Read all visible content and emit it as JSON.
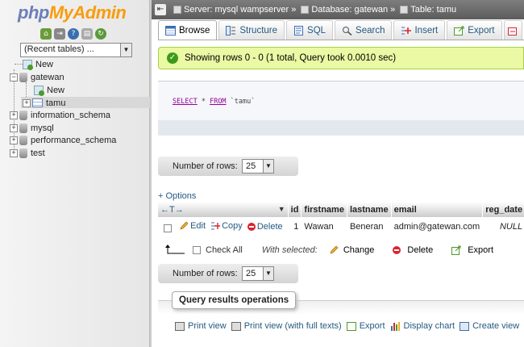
{
  "nav": {
    "logo_php": "php",
    "logo_myadmin": "MyAdmin",
    "recent_tables": "(Recent tables) ...",
    "tree": [
      {
        "label": "New"
      },
      {
        "label": "gatewan"
      },
      {
        "label": "New"
      },
      {
        "label": "tamu"
      },
      {
        "label": "information_schema"
      },
      {
        "label": "mysql"
      },
      {
        "label": "performance_schema"
      },
      {
        "label": "test"
      }
    ]
  },
  "breadcrumb": {
    "server": "Server: mysql wampserver",
    "sep1": "»",
    "database": "Database: gatewan",
    "sep2": "»",
    "table": "Table: tamu"
  },
  "tabs": [
    {
      "label": "Browse"
    },
    {
      "label": "Structure"
    },
    {
      "label": "SQL"
    },
    {
      "label": "Search"
    },
    {
      "label": "Insert"
    },
    {
      "label": "Export"
    }
  ],
  "success_message": "Showing rows 0 - 0 (1 total, Query took 0.0010 sec)",
  "sql": {
    "select": "SELECT",
    "star": " * ",
    "from": "FROM",
    "table": " `tamu`"
  },
  "rows_control": {
    "label": "Number of rows:",
    "value": "25"
  },
  "options_link": "+ Options",
  "table": {
    "sort_arrows": "←T→",
    "columns": [
      "id",
      "firstname",
      "lastname",
      "email",
      "reg_date"
    ],
    "row_actions": {
      "edit": "Edit",
      "copy": "Copy",
      "delete": "Delete"
    },
    "rows": [
      {
        "id": "1",
        "firstname": "Wawan",
        "lastname": "Beneran",
        "email": "admin@gatewan.com",
        "reg_date": "NULL"
      }
    ]
  },
  "bulk": {
    "check_all": "Check All",
    "with_selected": "With selected:",
    "change": "Change",
    "delete": "Delete",
    "export": "Export"
  },
  "query_ops": {
    "legend": "Query results operations",
    "actions": [
      "Print view",
      "Print view (with full texts)",
      "Export",
      "Display chart",
      "Create view"
    ]
  },
  "colors": {
    "accent_link": "#235a81",
    "success_bg": "#ebf8a4",
    "delete_red": "#d8262f"
  }
}
